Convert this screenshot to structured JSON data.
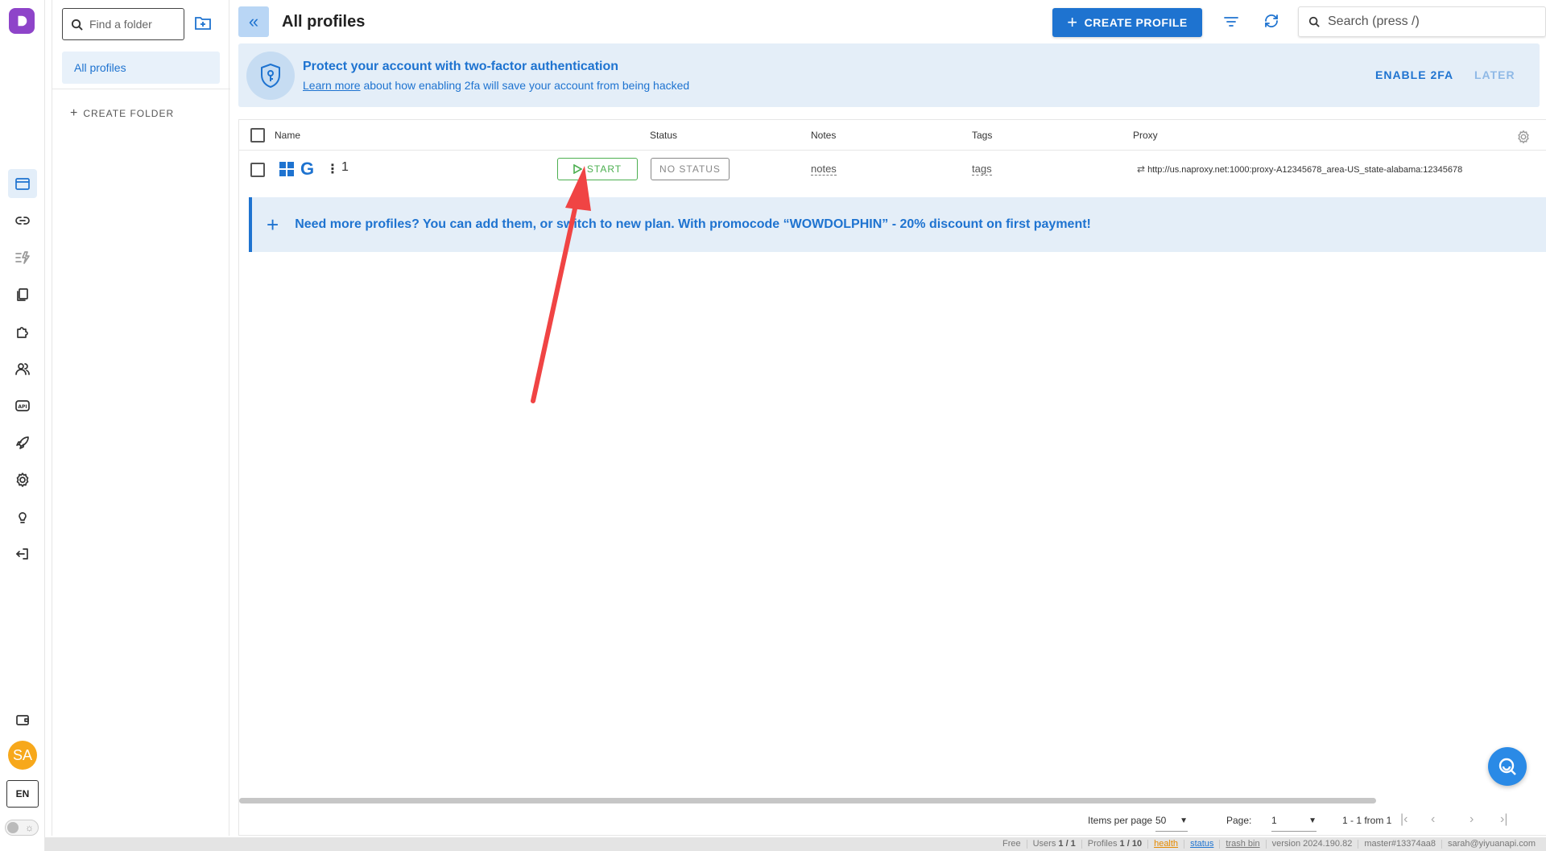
{
  "rail": {
    "icons": [
      "browser-profiles-icon",
      "link-icon",
      "automation-icon",
      "copy-icon",
      "extensions-icon",
      "users-icon",
      "api-icon",
      "rocket-icon",
      "settings-icon",
      "lightbulb-icon",
      "logout-icon",
      "wallet-icon"
    ],
    "avatar_initials": "SA",
    "language": "EN"
  },
  "folders": {
    "search_placeholder": "Find a folder",
    "items": [
      {
        "label": "All profiles"
      }
    ],
    "create_label": "CREATE FOLDER"
  },
  "header": {
    "title": "All profiles",
    "create_profile_label": "CREATE PROFILE",
    "search_placeholder": "Search (press /)"
  },
  "banner": {
    "title": "Protect your account with two-factor authentication",
    "link_text": "Learn more",
    "subtitle_rest": " about how enabling 2fa will save your account from being hacked",
    "enable_label": "ENABLE 2FA",
    "later_label": "LATER"
  },
  "table": {
    "columns": {
      "name": "Name",
      "status": "Status",
      "notes": "Notes",
      "tags": "Tags",
      "proxy": "Proxy"
    },
    "rows": [
      {
        "name": "1",
        "start_label": "START",
        "status_label": "NO STATUS",
        "notes": "notes",
        "tags": "tags",
        "proxy": "http://us.naproxy.net:1000:proxy-A12345678_area-US_state-alabama:12345678"
      }
    ],
    "promo": "Need more profiles? You can add them, or switch to new plan. With promocode “WOWDOLPHIN” - 20% discount on first payment!"
  },
  "pagination": {
    "items_per_page_label": "Items per page",
    "items_per_page": "50",
    "page_label": "Page:",
    "page": "1",
    "range": "1 - 1 from 1"
  },
  "footer": {
    "plan": "Free",
    "users_label": "Users",
    "users_value": "1 / 1",
    "profiles_label": "Profiles",
    "profiles_value": "1 / 10",
    "health": "health",
    "status": "status",
    "trash": "trash bin",
    "version": "version 2024.190.82",
    "build": "master#13374aa8",
    "email": "sarah@yiyuanapi.com"
  },
  "colors": {
    "accent": "#1e73d0",
    "start_green": "#4caf50",
    "annotation_red": "#f04444"
  }
}
